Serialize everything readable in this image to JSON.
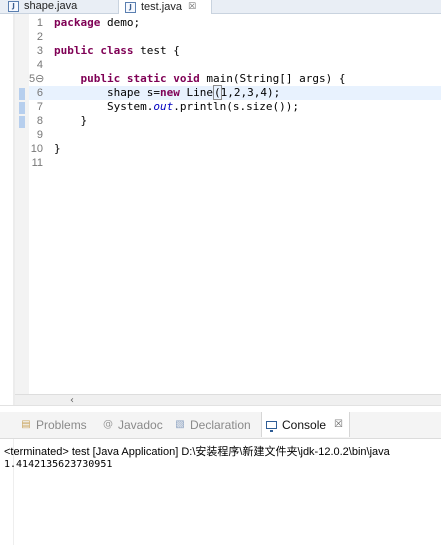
{
  "editor_tabs": [
    {
      "label": "shape.java",
      "icon": "java-file-icon",
      "active": false
    },
    {
      "label": "test.java",
      "icon": "java-file-icon",
      "active": true,
      "close": "☒"
    }
  ],
  "code": {
    "line_numbers": [
      "1",
      "2",
      "3",
      "4",
      "5⊖",
      "6",
      "7",
      "8",
      "9",
      "10",
      "11"
    ],
    "fold_marker": "⊖"
  },
  "bottom_tabs": {
    "problems": "Problems",
    "javadoc": "Javadoc",
    "declaration": "Declaration",
    "console": "Console",
    "console_close": "☒"
  },
  "console": {
    "header": "<terminated> test [Java Application] D:\\安装程序\\新建文件夹\\jdk-12.0.2\\bin\\java",
    "output": "1.4142135623730951"
  },
  "colors": {
    "keyword": "#7f0055",
    "static_field": "#0000c0",
    "current_line": "#e8f2fe"
  }
}
